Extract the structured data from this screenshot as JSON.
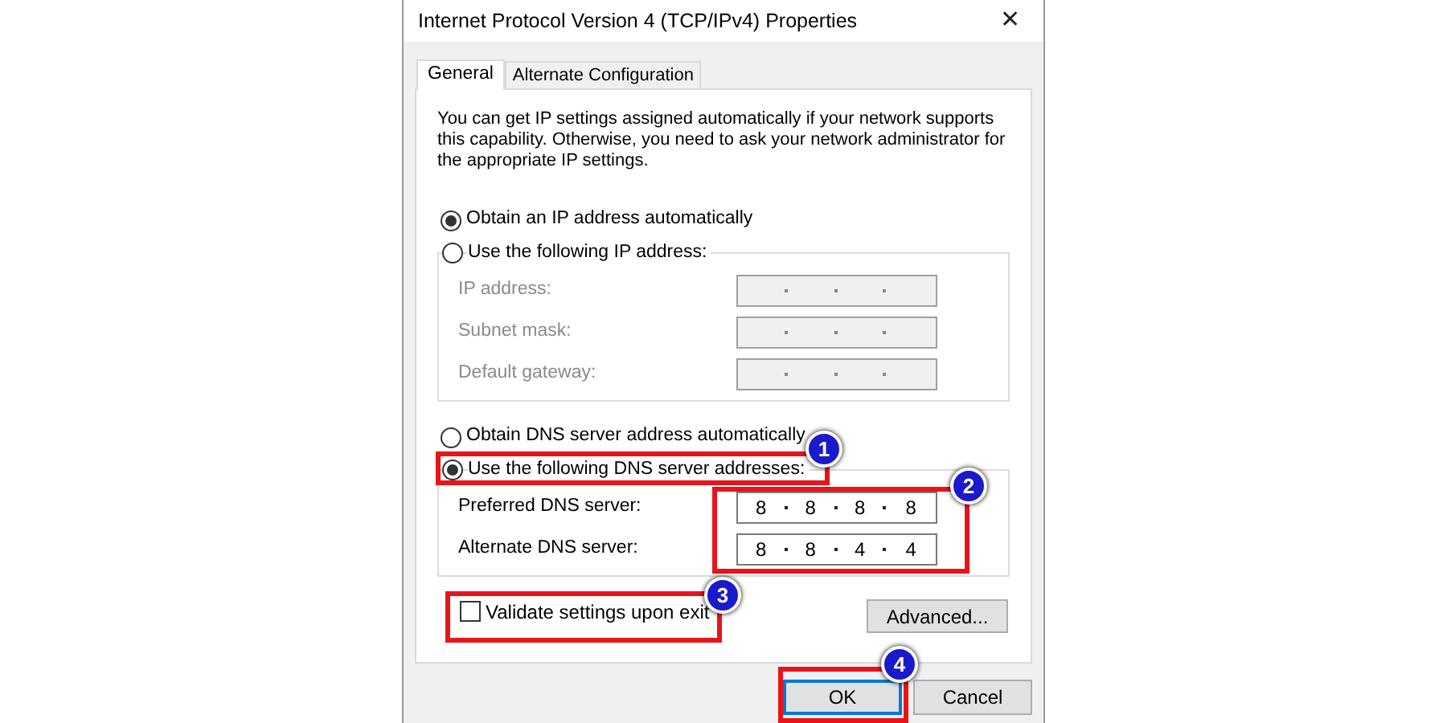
{
  "window": {
    "title": "Internet Protocol Version 4 (TCP/IPv4) Properties",
    "close": "✕"
  },
  "tabs": [
    {
      "label": "General",
      "selected": true
    },
    {
      "label": "Alternate Configuration",
      "selected": false
    }
  ],
  "intro": "You can get IP settings assigned automatically if your network supports this capability. Otherwise, you need to ask your network administrator for the appropriate IP settings.",
  "ip_mode": [
    {
      "label": "Obtain an IP address automatically",
      "selected": true
    },
    {
      "label": "Use the following IP address:",
      "selected": false
    }
  ],
  "ip_fields": [
    {
      "label": "IP address:",
      "disabled": true
    },
    {
      "label": "Subnet mask:",
      "disabled": true
    },
    {
      "label": "Default gateway:",
      "disabled": true
    }
  ],
  "dns_mode": [
    {
      "label": "Obtain DNS server address automatically",
      "selected": false
    },
    {
      "label": "Use the following DNS server addresses:",
      "selected": true
    }
  ],
  "dns_fields": [
    {
      "label": "Preferred DNS server:",
      "disabled": false,
      "octets": [
        "8",
        "8",
        "8",
        "8"
      ]
    },
    {
      "label": "Alternate DNS server:",
      "disabled": false,
      "octets": [
        "8",
        "8",
        "4",
        "4"
      ]
    }
  ],
  "validate": {
    "label": "Validate settings upon exit",
    "checked": false
  },
  "buttons": [
    {
      "label": "Advanced..."
    },
    {
      "label": "OK",
      "focused": true
    },
    {
      "label": "Cancel",
      "focused": false
    }
  ],
  "callouts": [
    "1",
    "2",
    "3",
    "4"
  ]
}
